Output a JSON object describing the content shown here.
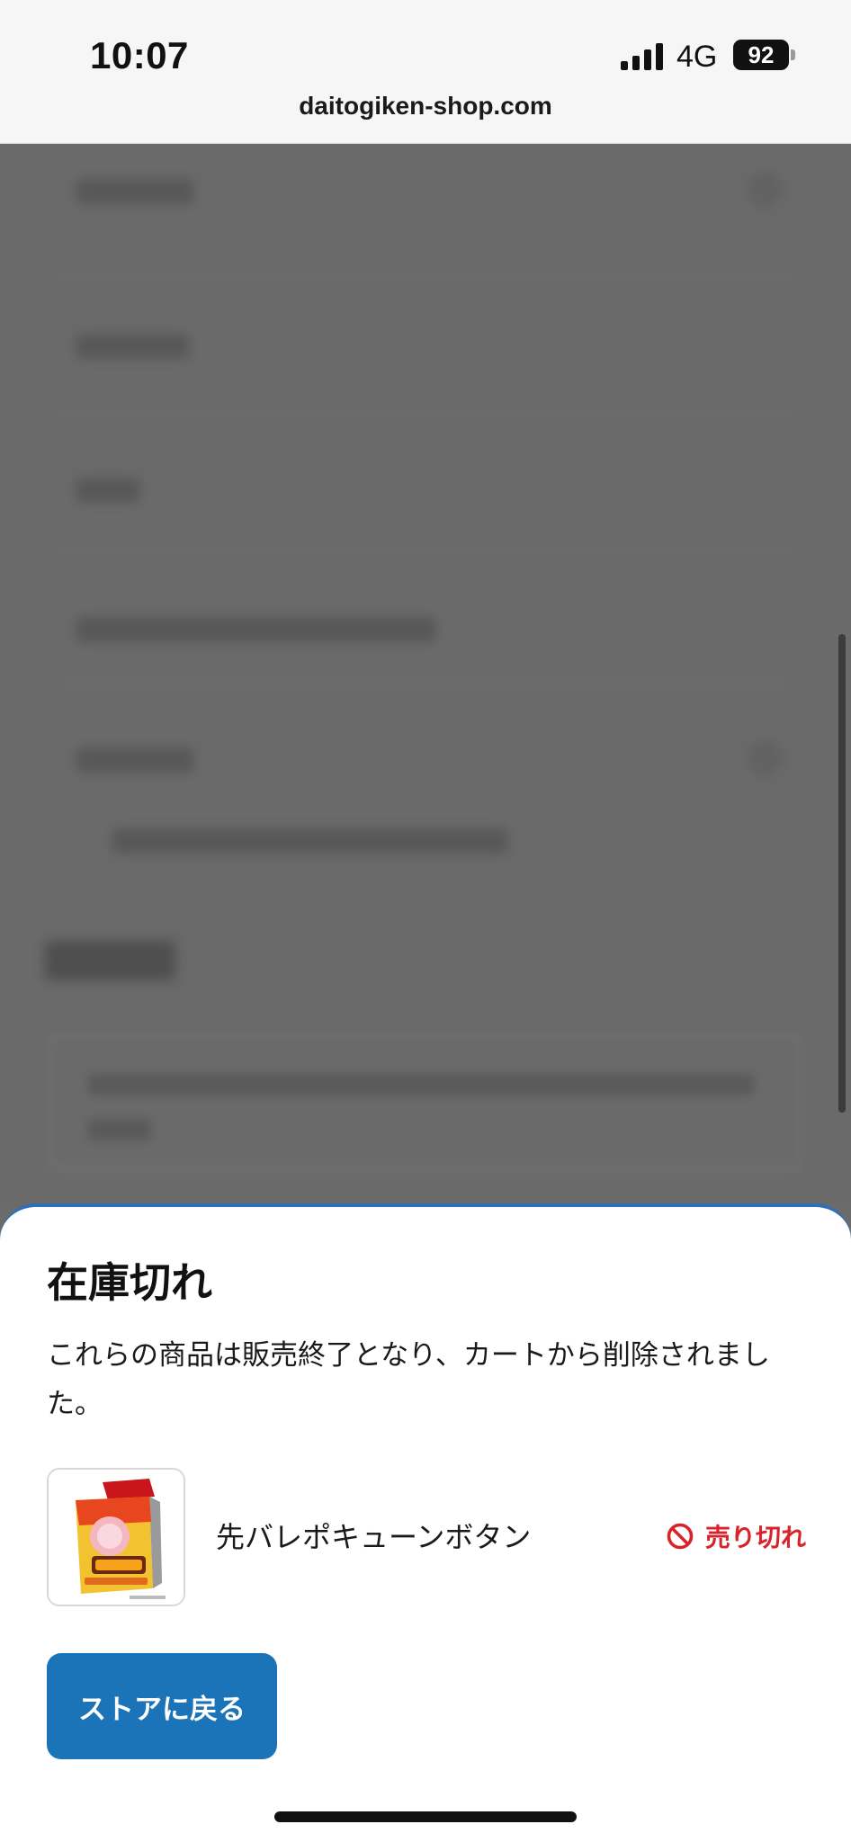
{
  "status_bar": {
    "time": "10:07",
    "network": "4G",
    "battery": "92"
  },
  "browser": {
    "url": "daitogiken-shop.com"
  },
  "modal": {
    "title": "在庫切れ",
    "message": "これらの商品は販売終了となり、カートから削除されました。",
    "product": {
      "name": "先バレポキューンボタン",
      "status": "売り切れ",
      "status_color": "#d8232a"
    },
    "primary_button": "ストアに戻る",
    "primary_color": "#1b74b8"
  }
}
